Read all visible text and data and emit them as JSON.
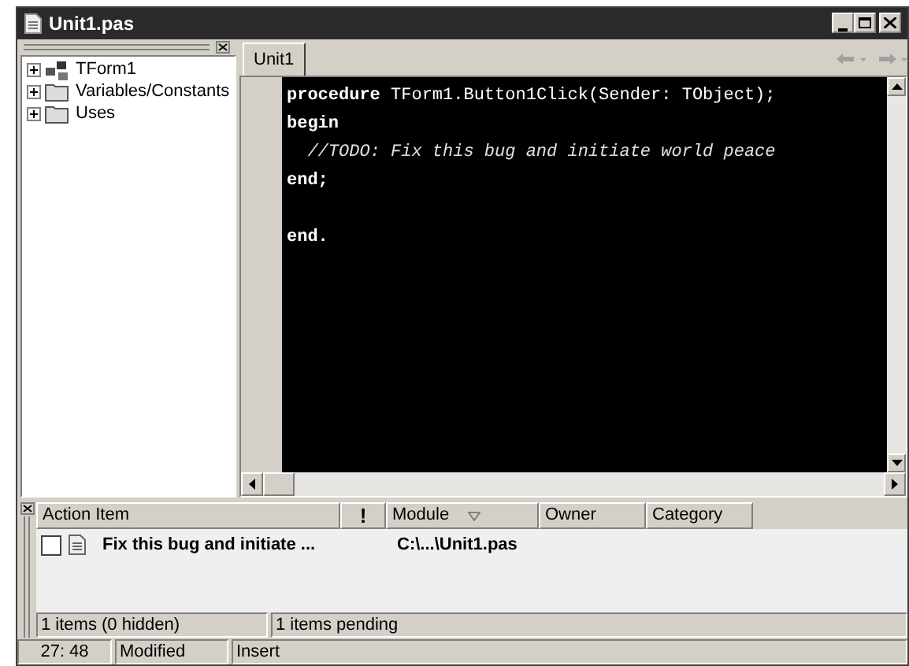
{
  "window": {
    "title": "Unit1.pas"
  },
  "tree": [
    {
      "label": "TForm1",
      "kind": "form",
      "expanded": false
    },
    {
      "label": "Variables/Constants",
      "kind": "folder",
      "expanded": false
    },
    {
      "label": "Uses",
      "kind": "folder",
      "expanded": false
    }
  ],
  "tabs": [
    {
      "label": "Unit1",
      "selected": true
    }
  ],
  "code": [
    {
      "kind": "code",
      "text": "**procedure** TForm1.Button1Click(Sender: TObject);"
    },
    {
      "kind": "code",
      "text": "**begin**"
    },
    {
      "kind": "comment",
      "text": "  //TODO: Fix this bug and initiate world peace"
    },
    {
      "kind": "code",
      "text": "**end;**"
    },
    {
      "kind": "blank"
    },
    {
      "kind": "code",
      "text": "**end.**"
    }
  ],
  "todo": {
    "columns": [
      "Action Item",
      "!",
      "Module",
      "Owner",
      "Category"
    ],
    "rows": [
      {
        "checked": false,
        "action_item": "Fix this bug and initiate ...",
        "module": "C:\\...\\Unit1.pas"
      }
    ],
    "status": [
      "1 items (0 hidden)",
      "1 items pending"
    ]
  },
  "status_bar": {
    "position": "27: 48",
    "modified": "Modified",
    "mode": "Insert"
  }
}
